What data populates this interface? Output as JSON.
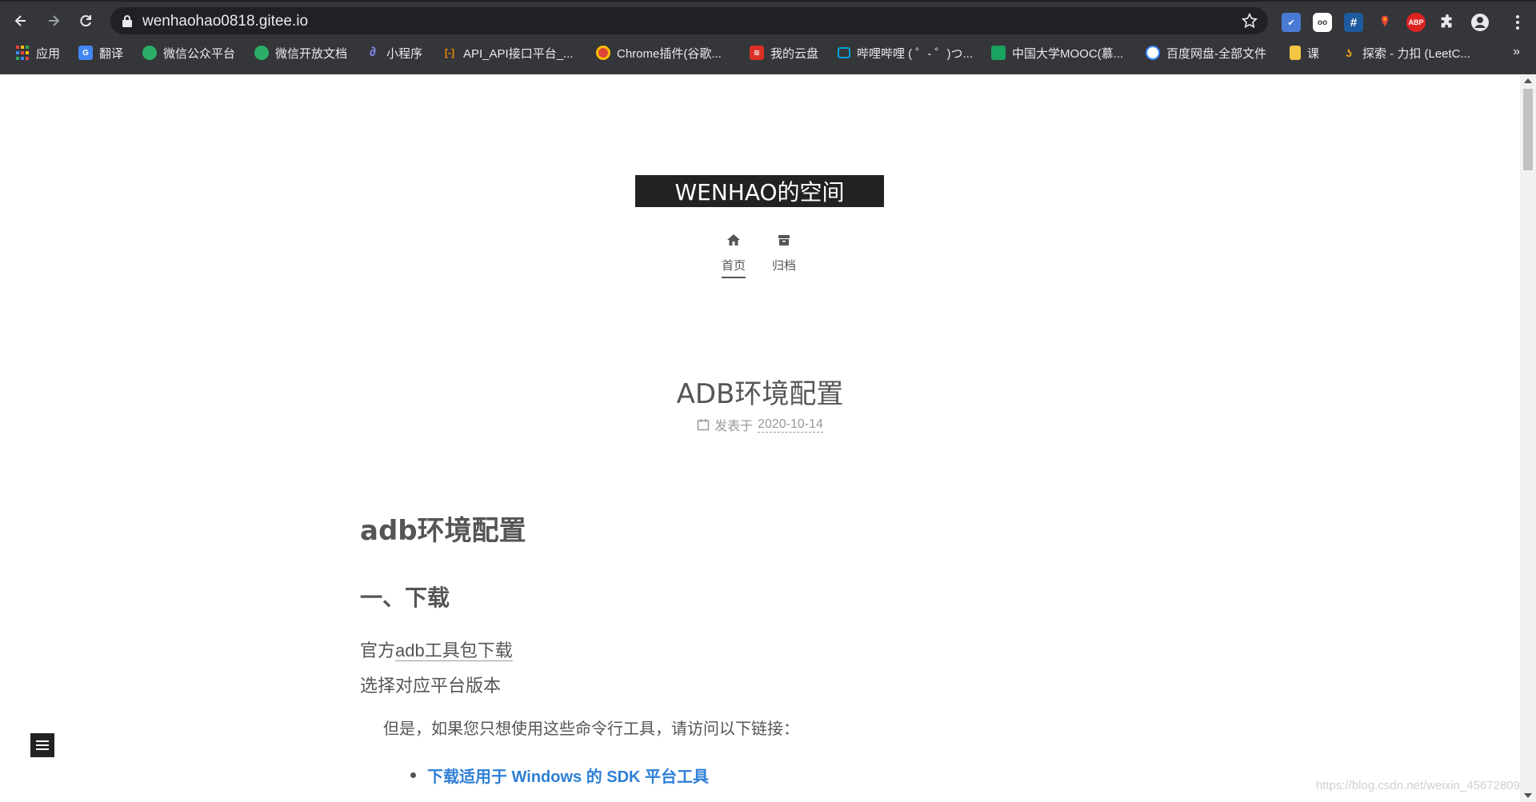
{
  "browser": {
    "url": "wenhaohao0818.gitee.io",
    "bookmarks": [
      {
        "label": "应用",
        "icon": "apps-grid-icon",
        "color": "#e8453c"
      },
      {
        "label": "翻译",
        "icon": "translate-icon",
        "color": "#4285f4"
      },
      {
        "label": "微信公众平台",
        "icon": "wechat-icon",
        "color": "#2aae67"
      },
      {
        "label": "微信开放文档",
        "icon": "wechat-icon",
        "color": "#2aae67"
      },
      {
        "label": "小程序",
        "icon": "miniprogram-icon",
        "color": "#6467f0"
      },
      {
        "label": "API_API接口平台_...",
        "icon": "api-icon",
        "color": "#f08c00"
      },
      {
        "label": "Chrome插件(谷歌...",
        "icon": "chrome-icon",
        "color": "#db4437"
      },
      {
        "label": "我的云盘",
        "icon": "cloud-drive-icon",
        "color": "#d93025"
      },
      {
        "label": "哔哩哔哩 ( ゜- ゜)つ...",
        "icon": "bilibili-icon",
        "color": "#00a1d6"
      },
      {
        "label": "中国大学MOOC(慕...",
        "icon": "mooc-icon",
        "color": "#1aa260"
      },
      {
        "label": "百度网盘-全部文件",
        "icon": "baidu-pan-icon",
        "color": "#3385ff"
      },
      {
        "label": "课",
        "icon": "folder-icon",
        "color": "#f4c542"
      },
      {
        "label": "探索 - 力扣 (LeetC...",
        "icon": "leetcode-icon",
        "color": "#f89f1b"
      }
    ],
    "more": "»",
    "extensions": [
      {
        "name": "ext-bird",
        "text": "",
        "color": "#4a7bd4"
      },
      {
        "name": "ext-glasses",
        "text": "oo",
        "color": "#555"
      },
      {
        "name": "ext-hash",
        "text": "#",
        "color": "#1e5a9e"
      },
      {
        "name": "ext-pin",
        "text": "",
        "color": "#e8453c"
      },
      {
        "name": "ext-abp",
        "text": "ABP",
        "color": "#d22"
      },
      {
        "name": "ext-puzzle",
        "text": "",
        "color": "#35363a"
      },
      {
        "name": "ext-profile",
        "text": "",
        "color": "#35363a"
      }
    ]
  },
  "site": {
    "brand": "WENHAO的空间",
    "menu": [
      {
        "label": "首页",
        "icon": "home-icon",
        "active": true
      },
      {
        "label": "归档",
        "icon": "archive-icon",
        "active": false
      }
    ]
  },
  "post": {
    "title": "ADB环境配置",
    "meta_prefix": "发表于",
    "date": "2020-10-14",
    "h1": "adb环境配置",
    "h2": "一、下载",
    "p1_prefix": "官方",
    "p1_link": "adb工具包下载",
    "p2": "选择对应平台版本",
    "quote": "但是，如果您只想使用这些命令行工具，请访问以下链接：",
    "list_link": "下载适用于 Windows 的 SDK 平台工具"
  },
  "watermark": "https://blog.csdn.net/weixin_45672809"
}
